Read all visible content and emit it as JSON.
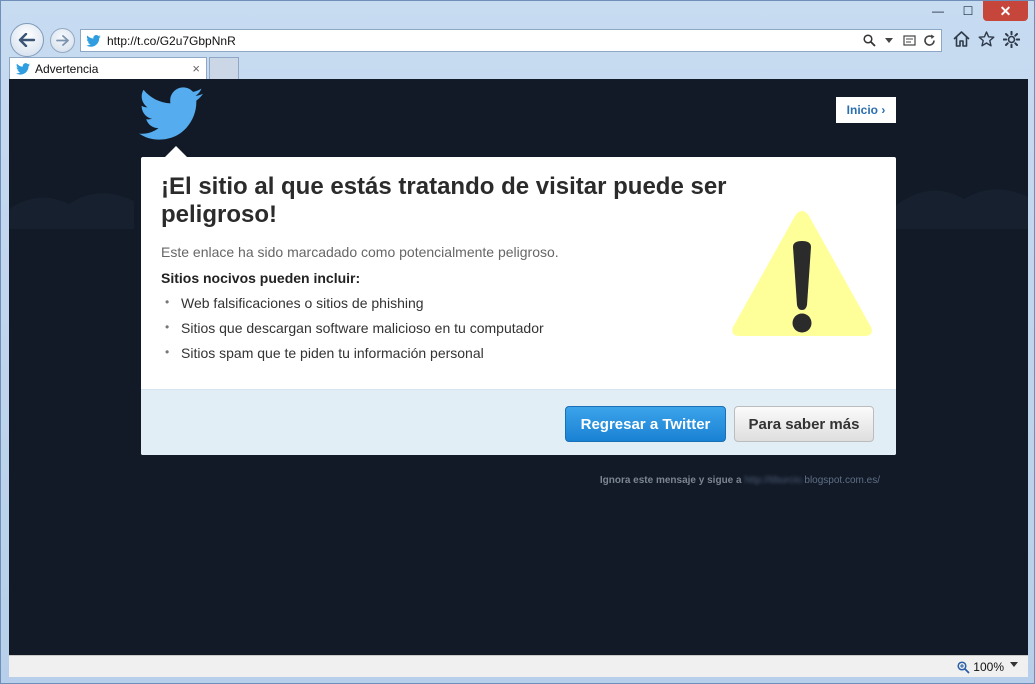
{
  "browser": {
    "url": "http://t.co/G2u7GbpNnR",
    "tab_label": "Advertencia",
    "zoom": "100%",
    "tab_close_glyph": "×",
    "minimize_glyph": "—",
    "maximize_glyph": "☐",
    "close_glyph": "✕"
  },
  "header": {
    "home_link": "Inicio ›"
  },
  "warning": {
    "title": "¡El sitio al que estás tratando de visitar puede ser peligroso!",
    "description": "Este enlace ha sido marcadado como potencialmente peligroso.",
    "list_heading": "Sitios nocivos pueden incluir:",
    "items": [
      "Web falsificaciones o sitios de phishing",
      "Sitios que descargan software malicioso en tu computador",
      "Sitios spam que te piden tu información personal"
    ],
    "primary_button": "Regresar a Twitter",
    "secondary_button": "Para saber más"
  },
  "footer": {
    "ignore_text": "Ignora este mensaje y sigue a",
    "ignore_url_blurred": "http://tiburcio.",
    "ignore_url_domain": "blogspot.com.es/"
  },
  "colors": {
    "page_bg": "#121a27",
    "twitter_blue": "#55acee",
    "warning_yellow": "#ffff99",
    "primary_button": "#2591de"
  }
}
